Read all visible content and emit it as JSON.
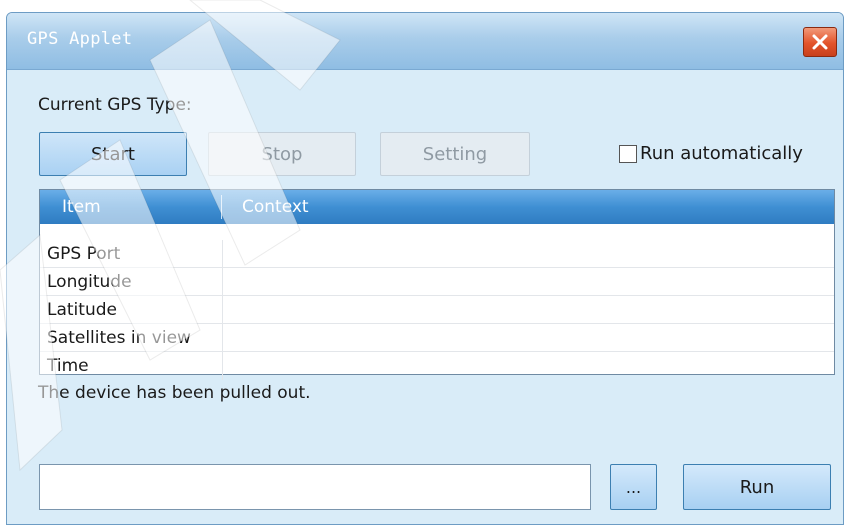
{
  "window": {
    "title": "GPS Applet"
  },
  "gps": {
    "type_label": "Current GPS Type:"
  },
  "buttons": {
    "start": "Start",
    "stop": "Stop",
    "setting": "Setting",
    "browse": "...",
    "run": "Run"
  },
  "options": {
    "run_automatically_label": "Run automatically",
    "run_automatically_checked": false
  },
  "table": {
    "columns": [
      "Item",
      "Context"
    ],
    "rows": [
      {
        "item": "GPS Port",
        "context": ""
      },
      {
        "item": "Longitude",
        "context": ""
      },
      {
        "item": "Latitude",
        "context": ""
      },
      {
        "item": "Satellites in view",
        "context": ""
      },
      {
        "item": "Time",
        "context": ""
      }
    ]
  },
  "status": {
    "message": "The device has been pulled out."
  },
  "path_input": {
    "value": ""
  },
  "colors": {
    "window_bg": "#d9ecf8",
    "header_blue": "#3f8fd3",
    "close_red": "#e2532a"
  }
}
